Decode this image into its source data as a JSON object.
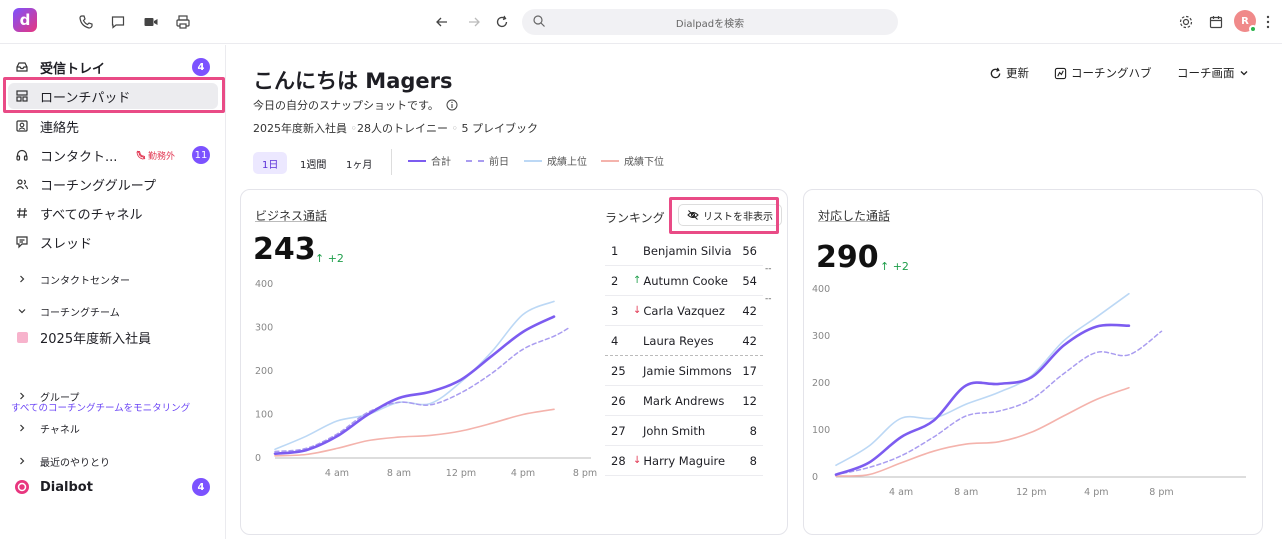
{
  "topbar": {
    "search_placeholder": "Dialpadを検索",
    "avatar_initial": "R"
  },
  "sidebar": {
    "items": [
      {
        "label": "受信トレイ",
        "badge": "4"
      },
      {
        "label": "ローンチパッド"
      },
      {
        "label": "連絡先"
      },
      {
        "label": "コンタクト...",
        "status": "勤務外",
        "badge": "11"
      },
      {
        "label": "コーチンググループ"
      },
      {
        "label": "すべてのチャネル"
      },
      {
        "label": "スレッド"
      }
    ],
    "sections": {
      "contact_center": "コンタクトセンター",
      "coaching_team": "コーチングチーム",
      "team_item": "2025年度新入社員",
      "monitor_link": "すべてのコーチングチームをモニタリング",
      "groups": "グループ",
      "channels": "チャネル",
      "recent": "最近のやりとり",
      "dialbot": "Dialbot",
      "dialbot_badge": "4"
    }
  },
  "header": {
    "greeting": "こんにちは Magers",
    "subtitle": "今日の自分のスナップショットです。",
    "meta_team": "2025年度新入社員",
    "meta_trainees": "28人のトレイニー",
    "meta_playbooks": "5 プレイブック",
    "refresh": "更新",
    "coaching_hub": "コーチングハブ",
    "coach_screen": "コーチ画面"
  },
  "ranges": [
    "1日",
    "1週間",
    "1ヶ月"
  ],
  "legend": [
    {
      "label": "合計",
      "color": "#7c5cf0",
      "style": "solid"
    },
    {
      "label": "前日",
      "color": "#a99cf0",
      "style": "dashed"
    },
    {
      "label": "成績上位",
      "color": "#bcd8f5",
      "style": "solid"
    },
    {
      "label": "成績下位",
      "color": "#f4b3ac",
      "style": "solid"
    }
  ],
  "business_calls": {
    "title": "ビジネス通話",
    "value": "243",
    "delta": "+2"
  },
  "handled_calls": {
    "title": "対応した通話",
    "value": "290",
    "delta": "+2"
  },
  "ranking": {
    "title": "ランキング",
    "hide_button": "リストを非表示",
    "rows": [
      {
        "rank": "1",
        "name": "Benjamin Silvia",
        "value": "56",
        "trend": ""
      },
      {
        "rank": "2",
        "name": "Autumn Cooke",
        "value": "54",
        "trend": "up"
      },
      {
        "rank": "3",
        "name": "Carla Vazquez",
        "value": "42",
        "trend": "down"
      },
      {
        "rank": "4",
        "name": "Laura Reyes",
        "value": "42",
        "trend": ""
      },
      {
        "rank": "25",
        "name": "Jamie Simmons",
        "value": "17",
        "trend": ""
      },
      {
        "rank": "26",
        "name": "Mark Andrews",
        "value": "12",
        "trend": ""
      },
      {
        "rank": "27",
        "name": "John Smith",
        "value": "8",
        "trend": ""
      },
      {
        "rank": "28",
        "name": "Harry Maguire",
        "value": "8",
        "trend": "down"
      }
    ]
  },
  "chart_data": [
    {
      "type": "line",
      "title": "ビジネス通話",
      "x_ticks": [
        "4 am",
        "8 am",
        "12 pm",
        "4 pm",
        "8 pm"
      ],
      "y_ticks": [
        0,
        100,
        200,
        300,
        400
      ],
      "ylim": [
        0,
        400
      ],
      "x_hours": [
        0,
        2,
        4,
        6,
        8,
        10,
        12,
        14,
        16,
        18,
        19
      ],
      "series": [
        {
          "name": "合計",
          "values": [
            10,
            18,
            50,
            100,
            138,
            152,
            180,
            235,
            290,
            325,
            null
          ]
        },
        {
          "name": "前日",
          "values": [
            15,
            22,
            55,
            105,
            128,
            122,
            150,
            195,
            250,
            280,
            300
          ]
        },
        {
          "name": "成績上位",
          "values": [
            20,
            50,
            85,
            100,
            128,
            125,
            175,
            245,
            330,
            360,
            null
          ]
        },
        {
          "name": "成績下位",
          "values": [
            5,
            8,
            22,
            40,
            48,
            52,
            62,
            80,
            100,
            112,
            null
          ]
        }
      ]
    },
    {
      "type": "line",
      "title": "対応した通話",
      "x_ticks": [
        "4 am",
        "8 am",
        "12 pm",
        "4 pm",
        "8 pm"
      ],
      "y_ticks": [
        0,
        100,
        200,
        300,
        400
      ],
      "ylim": [
        0,
        400
      ],
      "x_hours": [
        0,
        2,
        4,
        6,
        8,
        10,
        12,
        14,
        16,
        18,
        20
      ],
      "series": [
        {
          "name": "合計",
          "values": [
            5,
            30,
            85,
            120,
            195,
            198,
            212,
            280,
            320,
            322,
            null
          ]
        },
        {
          "name": "前日",
          "values": [
            5,
            20,
            45,
            85,
            130,
            140,
            165,
            220,
            265,
            260,
            310
          ]
        },
        {
          "name": "成績上位",
          "values": [
            25,
            65,
            125,
            125,
            155,
            180,
            215,
            290,
            340,
            390,
            null
          ]
        },
        {
          "name": "成績下位",
          "values": [
            2,
            5,
            30,
            55,
            70,
            75,
            95,
            130,
            165,
            190,
            null
          ]
        }
      ]
    }
  ]
}
